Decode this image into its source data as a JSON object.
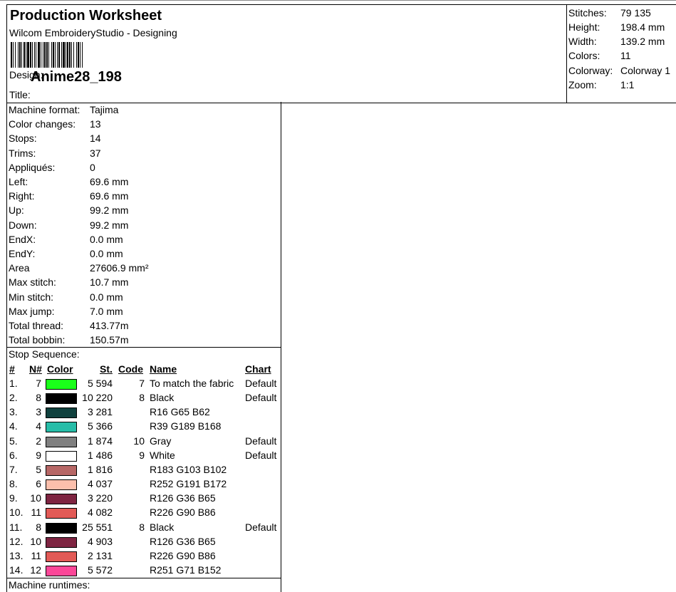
{
  "header": {
    "title": "Production Worksheet",
    "subtitle": "Wilcom EmbroideryStudio - Designing",
    "design_label": "Design:",
    "design_name": "Anime28_198",
    "title_label": "Title:"
  },
  "stats": [
    {
      "label": "Stitches:",
      "value": "79 135"
    },
    {
      "label": "Height:",
      "value": "198.4 mm"
    },
    {
      "label": "Width:",
      "value": "139.2 mm"
    },
    {
      "label": "Colors:",
      "value": "11"
    },
    {
      "label": "Colorway:",
      "value": "Colorway 1"
    },
    {
      "label": "Zoom:",
      "value": "1:1"
    }
  ],
  "info": [
    {
      "label": "Machine format:",
      "value": "Tajima"
    },
    {
      "label": "Color changes:",
      "value": "13"
    },
    {
      "label": "Stops:",
      "value": "14"
    },
    {
      "label": "Trims:",
      "value": "37"
    },
    {
      "label": "Appliqués:",
      "value": "0"
    },
    {
      "label": "Left:",
      "value": "69.6 mm"
    },
    {
      "label": "Right:",
      "value": "69.6 mm"
    },
    {
      "label": "Up:",
      "value": "99.2 mm"
    },
    {
      "label": "Down:",
      "value": "99.2 mm"
    },
    {
      "label": "EndX:",
      "value": "0.0 mm"
    },
    {
      "label": "EndY:",
      "value": "0.0 mm"
    },
    {
      "label": "Area",
      "value": "27606.9 mm²"
    },
    {
      "label": "Max stitch:",
      "value": "10.7 mm"
    },
    {
      "label": "Min stitch:",
      "value": "0.0 mm"
    },
    {
      "label": "Max jump:",
      "value": "7.0 mm"
    },
    {
      "label": "Total thread:",
      "value": "413.77m"
    },
    {
      "label": "Total bobbin:",
      "value": "150.57m"
    }
  ],
  "stop_sequence": {
    "title": "Stop Sequence:",
    "headers": {
      "num": "#",
      "n": "N#",
      "color": "Color",
      "st": "St.",
      "code": "Code",
      "name": "Name",
      "chart": "Chart"
    },
    "rows": [
      {
        "num": "1.",
        "n": "7",
        "color": "#1aff1a",
        "st": "5 594",
        "code": "7",
        "name": "To match the fabric",
        "chart": "Default"
      },
      {
        "num": "2.",
        "n": "8",
        "color": "#000000",
        "st": "10 220",
        "code": "8",
        "name": "Black",
        "chart": "Default"
      },
      {
        "num": "3.",
        "n": "3",
        "color": "#10413e",
        "st": "3 281",
        "code": "",
        "name": "R16 G65 B62",
        "chart": ""
      },
      {
        "num": "4.",
        "n": "4",
        "color": "#27bda8",
        "st": "5 366",
        "code": "",
        "name": "R39 G189 B168",
        "chart": ""
      },
      {
        "num": "5.",
        "n": "2",
        "color": "#808080",
        "st": "1 874",
        "code": "10",
        "name": "Gray",
        "chart": "Default"
      },
      {
        "num": "6.",
        "n": "9",
        "color": "#ffffff",
        "st": "1 486",
        "code": "9",
        "name": "White",
        "chart": "Default"
      },
      {
        "num": "7.",
        "n": "5",
        "color": "#b76766",
        "st": "1 816",
        "code": "",
        "name": "R183 G103 B102",
        "chart": ""
      },
      {
        "num": "8.",
        "n": "6",
        "color": "#fcbfac",
        "st": "4 037",
        "code": "",
        "name": "R252 G191 B172",
        "chart": ""
      },
      {
        "num": "9.",
        "n": "10",
        "color": "#7e2441",
        "st": "3 220",
        "code": "",
        "name": "R126 G36 B65",
        "chart": ""
      },
      {
        "num": "10.",
        "n": "11",
        "color": "#e25a56",
        "st": "4 082",
        "code": "",
        "name": "R226 G90 B86",
        "chart": ""
      },
      {
        "num": "11.",
        "n": "8",
        "color": "#000000",
        "st": "25 551",
        "code": "8",
        "name": "Black",
        "chart": "Default"
      },
      {
        "num": "12.",
        "n": "10",
        "color": "#7e2441",
        "st": "4 903",
        "code": "",
        "name": "R126 G36 B65",
        "chart": ""
      },
      {
        "num": "13.",
        "n": "11",
        "color": "#e25a56",
        "st": "2 131",
        "code": "",
        "name": "R226 G90 B86",
        "chart": ""
      },
      {
        "num": "14.",
        "n": "12",
        "color": "#fb4798",
        "st": "5 572",
        "code": "",
        "name": "R251 G71 B152",
        "chart": ""
      }
    ]
  },
  "runtimes_label": "Machine runtimes:"
}
